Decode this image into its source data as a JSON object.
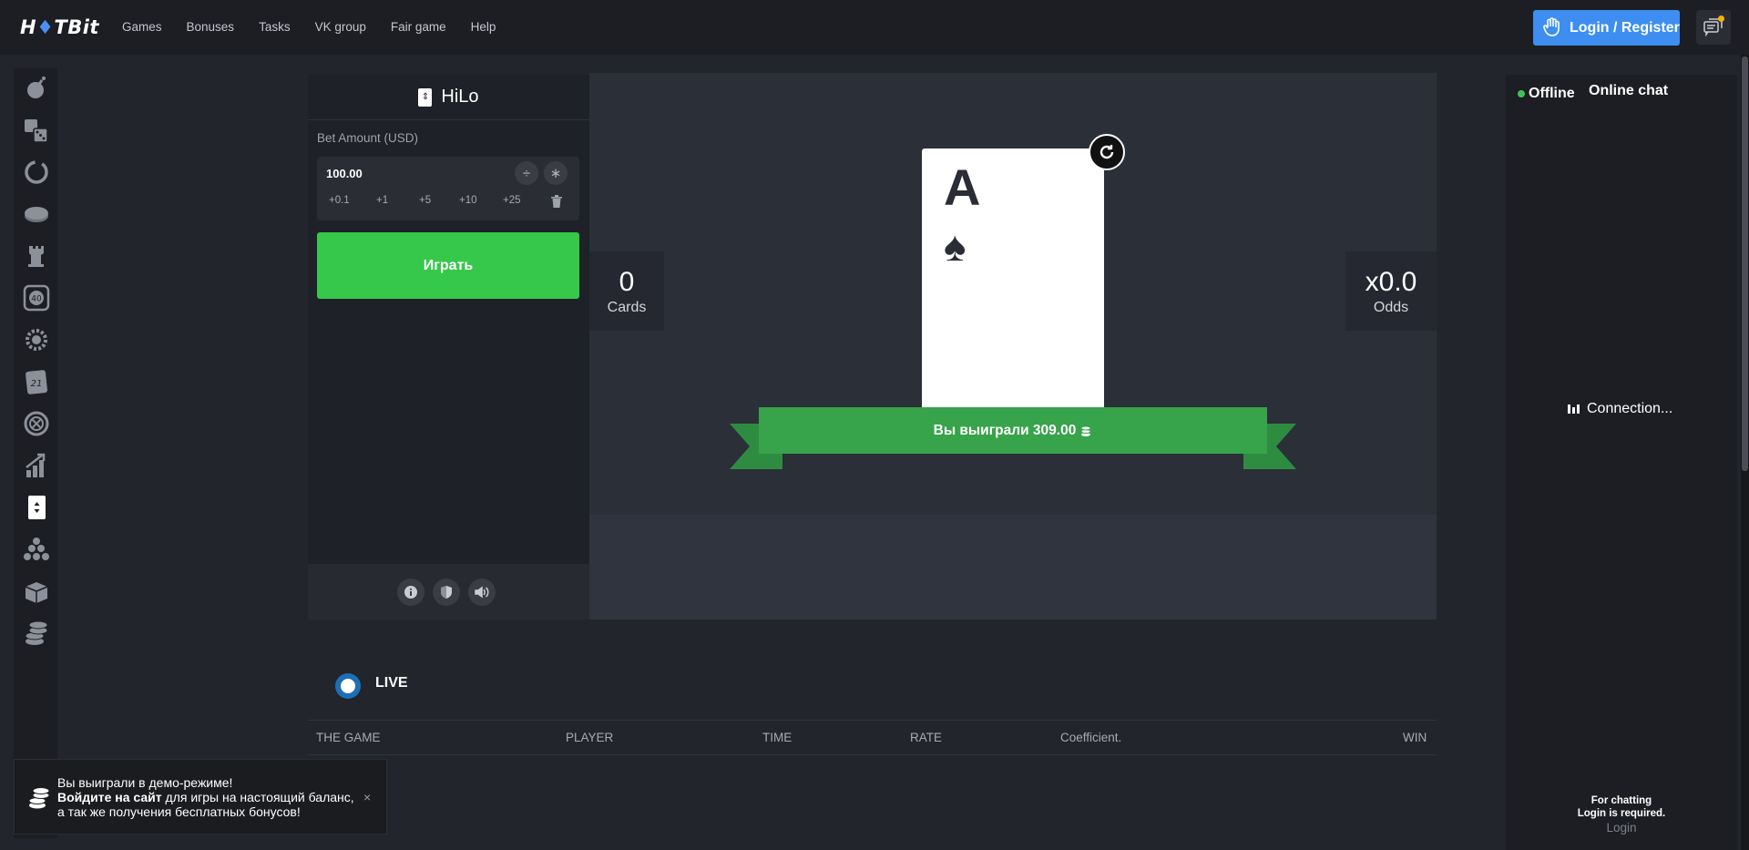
{
  "header": {
    "logo": "H♦TBit",
    "logo_left": "H",
    "logo_flame": "♦",
    "logo_right": "TBit",
    "nav": [
      "Games",
      "Bonuses",
      "Tasks",
      "VK group",
      "Fair game",
      "Help"
    ],
    "login_label": "Login / Register"
  },
  "sidebar": {
    "icons": [
      "bomb-icon",
      "dice-icon",
      "wheel-icon",
      "coin-icon",
      "tower-icon",
      "keno-icon",
      "gear-icon",
      "blackjack-icon",
      "roulette-icon",
      "crash-icon",
      "hilo-icon",
      "plinko-icon",
      "box-icon",
      "stack-icon"
    ]
  },
  "game_panel": {
    "title": "HiLo",
    "bet_label": "Bet Amount (USD)",
    "bet_value": "100.00",
    "divide_label": "÷",
    "multiply_label": "∗",
    "quick_bets": [
      "+0.1",
      "+1",
      "+5",
      "+10",
      "+25"
    ],
    "play_label": "Играть"
  },
  "game": {
    "cards_value": "0",
    "cards_label": "Cards",
    "odds_value": "x0.0",
    "odds_label": "Odds",
    "card_rank": "A",
    "card_suit": "♠",
    "win_message": "Вы выиграли 309.00"
  },
  "live": {
    "label": "LIVE",
    "columns": [
      "THE GAME",
      "PLAYER",
      "TIME",
      "RATE",
      "Coefficient.",
      "WIN"
    ]
  },
  "chat": {
    "status": "Offline",
    "title": "Online chat",
    "connecting": "Connection...",
    "note_line1": "For chatting",
    "note_line2": "Login is required.",
    "login_link": "Login"
  },
  "toast": {
    "line1": "Вы выиграли в демо-режиме!",
    "line2_bold": "Войдите на сайт",
    "line2_rest": " для игры на настоящий баланс,",
    "line3": "а так же получения бесплатных бонусов!",
    "close": "×"
  },
  "colors": {
    "accent_blue": "#3d8ef0",
    "play_green": "#36c84b",
    "ribbon_green": "#37a34a",
    "online_green": "#3cc35a",
    "background": "#22252c"
  }
}
